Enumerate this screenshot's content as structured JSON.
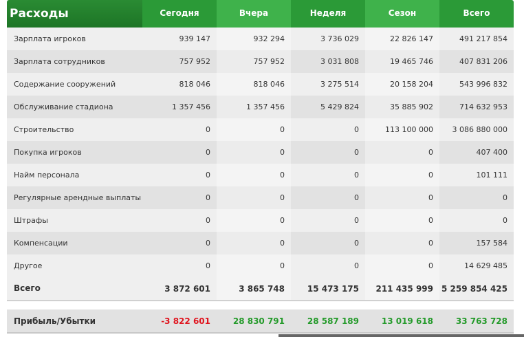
{
  "table": {
    "title": "Расходы",
    "columns": [
      "Сегодня",
      "Вчера",
      "Неделя",
      "Сезон",
      "Всего"
    ],
    "rows": [
      {
        "label": "Зарплата игроков",
        "values": [
          "939 147",
          "932 294",
          "3 736 029",
          "22 826 147",
          "491 217 854"
        ]
      },
      {
        "label": "Зарплата сотрудников",
        "values": [
          "757 952",
          "757 952",
          "3 031 808",
          "19 465 746",
          "407 831 206"
        ]
      },
      {
        "label": "Содержание сооружений",
        "values": [
          "818 046",
          "818 046",
          "3 275 514",
          "20 158 204",
          "543 996 832"
        ]
      },
      {
        "label": "Обслуживание стадиона",
        "values": [
          "1 357 456",
          "1 357 456",
          "5 429 824",
          "35 885 902",
          "714 632 953"
        ]
      },
      {
        "label": "Строительство",
        "values": [
          "0",
          "0",
          "0",
          "113 100 000",
          "3 086 880 000"
        ]
      },
      {
        "label": "Покупка игроков",
        "values": [
          "0",
          "0",
          "0",
          "0",
          "407 400"
        ]
      },
      {
        "label": "Найм персонала",
        "values": [
          "0",
          "0",
          "0",
          "0",
          "101 111"
        ]
      },
      {
        "label": "Регулярные арендные выплаты",
        "values": [
          "0",
          "0",
          "0",
          "0",
          "0"
        ]
      },
      {
        "label": "Штрафы",
        "values": [
          "0",
          "0",
          "0",
          "0",
          "0"
        ]
      },
      {
        "label": "Компенсации",
        "values": [
          "0",
          "0",
          "0",
          "0",
          "157 584"
        ]
      },
      {
        "label": "Другое",
        "values": [
          "0",
          "0",
          "0",
          "0",
          "14 629 485"
        ]
      }
    ],
    "total": {
      "label": "Всего",
      "values": [
        "3 872 601",
        "3 865 748",
        "15 473 175",
        "211 435 999",
        "5 259 854 425"
      ]
    }
  },
  "profit": {
    "label": "Прибыль/Убытки",
    "values": [
      "-3 822 601",
      "28 830 791",
      "28 587 189",
      "13 019 618",
      "33 763 728"
    ]
  },
  "colors": {
    "header_dark": "#2b9a37",
    "header_light": "#3fb24b",
    "negative": "#e0141e",
    "positive": "#249a2a"
  }
}
